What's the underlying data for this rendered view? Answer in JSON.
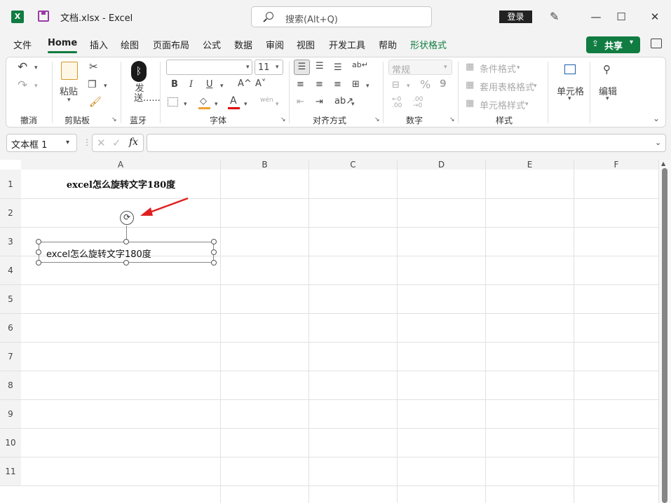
{
  "window": {
    "app_icon": "X",
    "title": "文档.xlsx  -  Excel",
    "search_placeholder": "搜索(Alt+Q)",
    "login_label": "登录",
    "minimize": "—",
    "maximize": "☐",
    "close": "✕"
  },
  "menu": {
    "tabs": [
      "文件",
      "Home",
      "插入",
      "绘图",
      "页面布局",
      "公式",
      "数据",
      "审阅",
      "视图",
      "开发工具",
      "帮助",
      "形状格式"
    ],
    "share_label": "共享"
  },
  "ribbon": {
    "undo_group": "撤消",
    "clipboard": {
      "paste": "粘贴",
      "group": "剪贴板"
    },
    "bluetooth": {
      "send": "发送......",
      "group": "蓝牙"
    },
    "font": {
      "size": "11",
      "bold": "B",
      "italic": "I",
      "underline": "U",
      "grow": "A^",
      "shrink": "A˅",
      "group": "字体"
    },
    "alignment": {
      "group": "对齐方式"
    },
    "number": {
      "format": "常规",
      "percent": "%",
      "comma": "9",
      "group": "数字"
    },
    "styles": {
      "conditional": "条件格式",
      "table": "套用表格格式",
      "cell": "单元格样式",
      "group": "样式"
    },
    "cells": {
      "label": "单元格"
    },
    "editing": {
      "label": "编辑"
    }
  },
  "formula_bar": {
    "namebox": "文本框 1",
    "fx": "fx",
    "value": ""
  },
  "sheet": {
    "columns": [
      "A",
      "B",
      "C",
      "D",
      "E",
      "F"
    ],
    "rows": [
      "1",
      "2",
      "3",
      "4",
      "5",
      "6",
      "7",
      "8",
      "9",
      "10",
      "11"
    ],
    "cell_a1": "excel怎么旋转文字180度",
    "textbox_text": "excel怎么旋转文字180度"
  },
  "colors": {
    "accent": "#107c41",
    "annotation_arrow": "#e02020"
  }
}
